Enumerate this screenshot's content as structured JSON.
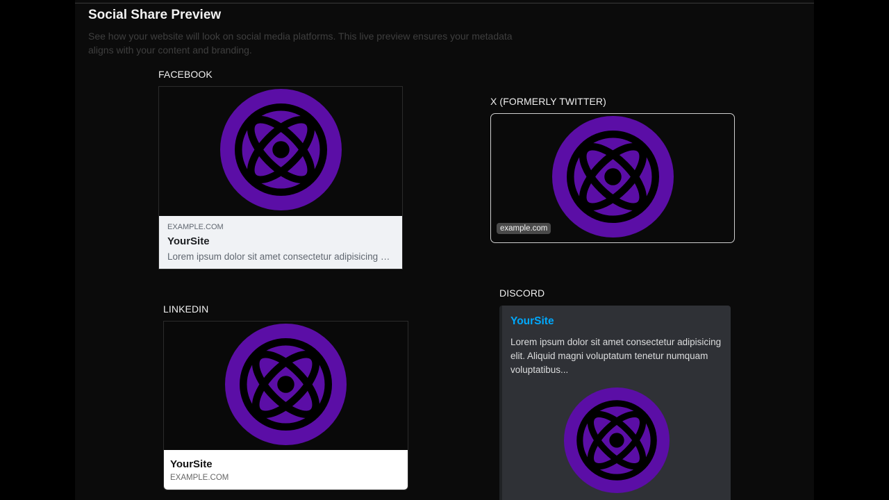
{
  "header": {
    "title": "Social Share Preview",
    "subtitle": "See how your website will look on social media platforms. This live preview ensures your metadata aligns with your content and branding."
  },
  "facebook": {
    "label": "FACEBOOK",
    "domain": "EXAMPLE.COM",
    "title": "YourSite",
    "description": "Lorem ipsum dolor sit amet consectetur adipisicing elit. Aliquid magni voluptatum tenetur numquam voluptatibus..."
  },
  "x": {
    "label": "X (FORMERLY TWITTER)",
    "domain": "example.com"
  },
  "linkedin": {
    "label": "LINKEDIN",
    "title": "YourSite",
    "domain": "EXAMPLE.COM"
  },
  "discord": {
    "label": "DISCORD",
    "title": "YourSite",
    "description": "Lorem ipsum dolor sit amet consectetur adipisicing elit. Aliquid magni voluptatum tenetur numquam voluptatibus..."
  },
  "colors": {
    "logo_purple": "#5b0ea6",
    "discord_link": "#00a8fc",
    "discord_embed_bg": "#2f3136",
    "facebook_meta_bg": "#f0f2f5"
  },
  "icons": {
    "logo": "atom-logo-icon"
  }
}
